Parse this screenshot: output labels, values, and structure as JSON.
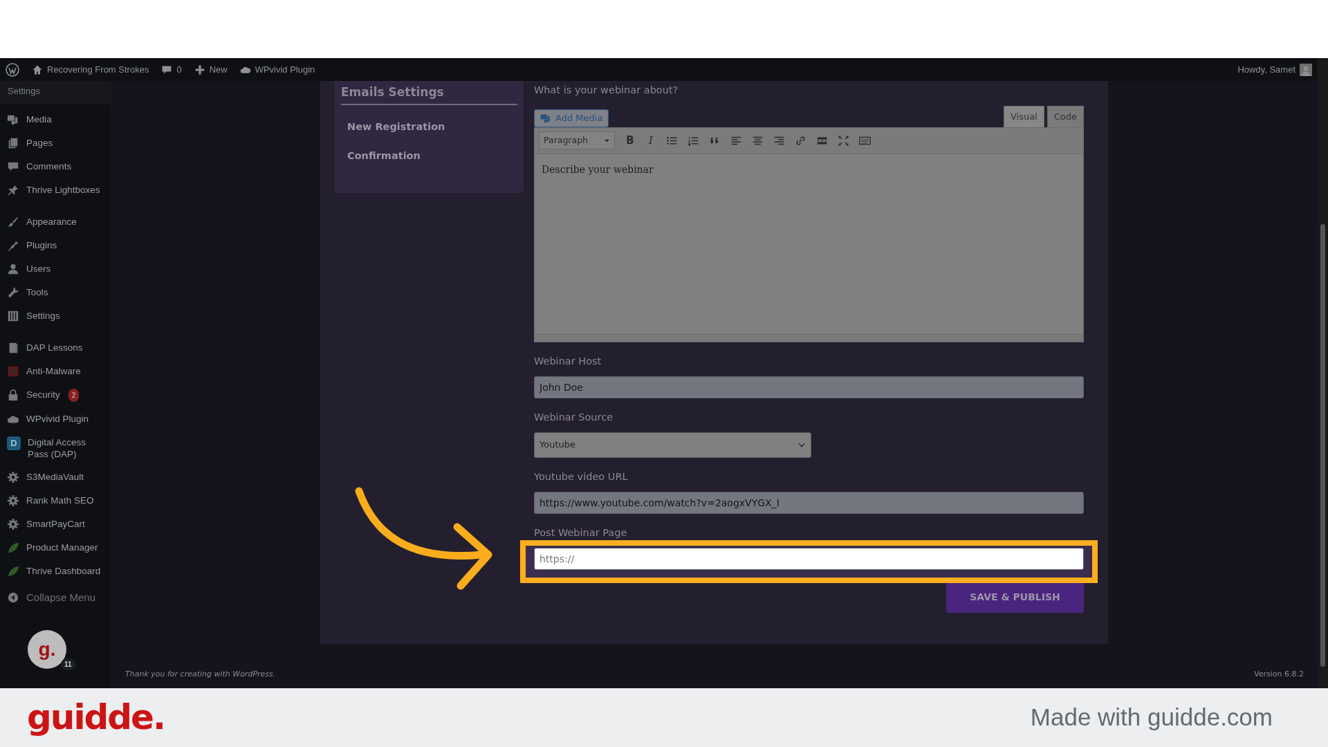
{
  "admin_bar": {
    "site": "Recovering From Strokes",
    "comments": "0",
    "new": "New",
    "plugin": "WPvivid Plugin",
    "greeting": "Howdy, Samet"
  },
  "sidebar": {
    "section": "Settings",
    "groups": [
      [
        {
          "label": "Media"
        },
        {
          "label": "Pages"
        },
        {
          "label": "Comments"
        },
        {
          "label": "Thrive Lightboxes"
        }
      ],
      [
        {
          "label": "Appearance"
        },
        {
          "label": "Plugins"
        },
        {
          "label": "Users"
        },
        {
          "label": "Tools"
        },
        {
          "label": "Settings"
        }
      ],
      [
        {
          "label": "DAP Lessons"
        },
        {
          "label": "Anti-Malware"
        },
        {
          "label": "Security",
          "badge": "2"
        },
        {
          "label": "WPvivid Plugin"
        },
        {
          "label": "Digital Access Pass (DAP)",
          "icon_letter": "D"
        },
        {
          "label": "S3MediaVault"
        },
        {
          "label": "Rank Math SEO"
        },
        {
          "label": "SmartPayCart"
        },
        {
          "label": "Product Manager"
        },
        {
          "label": "Thrive Dashboard"
        }
      ]
    ],
    "collapse": "Collapse Menu",
    "avatar": {
      "letter": "g.",
      "count": "11"
    }
  },
  "settings_nav": {
    "title": "Emails Settings",
    "items": [
      "New Registration",
      "Confirmation"
    ]
  },
  "form": {
    "about_label": "What is your webinar about?",
    "add_media": "Add Media",
    "editor_tabs": [
      {
        "label": "Visual",
        "selected": true
      },
      {
        "label": "Code",
        "selected": false
      }
    ],
    "format": "Paragraph",
    "bold_glyph": "B",
    "italic_glyph": "I",
    "editor_text": "Describe your webinar",
    "fields": [
      {
        "kind": "text",
        "label": "Webinar Host",
        "value": "John Doe",
        "highlighted": false
      },
      {
        "kind": "select",
        "label": "Webinar Source",
        "value": "Youtube",
        "highlighted": false
      },
      {
        "kind": "text",
        "label": "Youtube video URL",
        "value": "https://www.youtube.com/watch?v=2aogxVYGX_I",
        "highlighted": false
      },
      {
        "kind": "text",
        "label": "Post Webinar Page",
        "placeholder": "https://",
        "highlighted": true
      }
    ],
    "submit": "SAVE & PUBLISH"
  },
  "footer": {
    "credit": "Thank you for creating with WordPress.",
    "version": "Version 6.8.2"
  },
  "branding": {
    "logo": "guidde.",
    "tagline": "Made with guidde.com"
  }
}
